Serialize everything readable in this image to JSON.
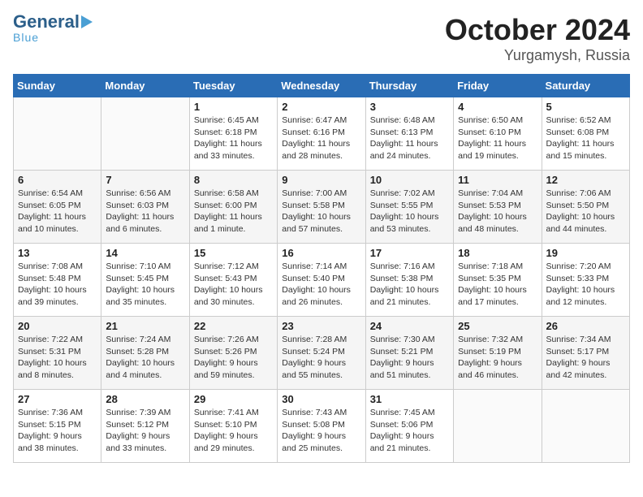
{
  "logo": {
    "line1": "General",
    "line2": "Blue"
  },
  "title": {
    "month": "October 2024",
    "location": "Yurgamysh, Russia"
  },
  "headers": [
    "Sunday",
    "Monday",
    "Tuesday",
    "Wednesday",
    "Thursday",
    "Friday",
    "Saturday"
  ],
  "weeks": [
    [
      {
        "day": "",
        "detail": ""
      },
      {
        "day": "",
        "detail": ""
      },
      {
        "day": "1",
        "detail": "Sunrise: 6:45 AM\nSunset: 6:18 PM\nDaylight: 11 hours\nand 33 minutes."
      },
      {
        "day": "2",
        "detail": "Sunrise: 6:47 AM\nSunset: 6:16 PM\nDaylight: 11 hours\nand 28 minutes."
      },
      {
        "day": "3",
        "detail": "Sunrise: 6:48 AM\nSunset: 6:13 PM\nDaylight: 11 hours\nand 24 minutes."
      },
      {
        "day": "4",
        "detail": "Sunrise: 6:50 AM\nSunset: 6:10 PM\nDaylight: 11 hours\nand 19 minutes."
      },
      {
        "day": "5",
        "detail": "Sunrise: 6:52 AM\nSunset: 6:08 PM\nDaylight: 11 hours\nand 15 minutes."
      }
    ],
    [
      {
        "day": "6",
        "detail": "Sunrise: 6:54 AM\nSunset: 6:05 PM\nDaylight: 11 hours\nand 10 minutes."
      },
      {
        "day": "7",
        "detail": "Sunrise: 6:56 AM\nSunset: 6:03 PM\nDaylight: 11 hours\nand 6 minutes."
      },
      {
        "day": "8",
        "detail": "Sunrise: 6:58 AM\nSunset: 6:00 PM\nDaylight: 11 hours\nand 1 minute."
      },
      {
        "day": "9",
        "detail": "Sunrise: 7:00 AM\nSunset: 5:58 PM\nDaylight: 10 hours\nand 57 minutes."
      },
      {
        "day": "10",
        "detail": "Sunrise: 7:02 AM\nSunset: 5:55 PM\nDaylight: 10 hours\nand 53 minutes."
      },
      {
        "day": "11",
        "detail": "Sunrise: 7:04 AM\nSunset: 5:53 PM\nDaylight: 10 hours\nand 48 minutes."
      },
      {
        "day": "12",
        "detail": "Sunrise: 7:06 AM\nSunset: 5:50 PM\nDaylight: 10 hours\nand 44 minutes."
      }
    ],
    [
      {
        "day": "13",
        "detail": "Sunrise: 7:08 AM\nSunset: 5:48 PM\nDaylight: 10 hours\nand 39 minutes."
      },
      {
        "day": "14",
        "detail": "Sunrise: 7:10 AM\nSunset: 5:45 PM\nDaylight: 10 hours\nand 35 minutes."
      },
      {
        "day": "15",
        "detail": "Sunrise: 7:12 AM\nSunset: 5:43 PM\nDaylight: 10 hours\nand 30 minutes."
      },
      {
        "day": "16",
        "detail": "Sunrise: 7:14 AM\nSunset: 5:40 PM\nDaylight: 10 hours\nand 26 minutes."
      },
      {
        "day": "17",
        "detail": "Sunrise: 7:16 AM\nSunset: 5:38 PM\nDaylight: 10 hours\nand 21 minutes."
      },
      {
        "day": "18",
        "detail": "Sunrise: 7:18 AM\nSunset: 5:35 PM\nDaylight: 10 hours\nand 17 minutes."
      },
      {
        "day": "19",
        "detail": "Sunrise: 7:20 AM\nSunset: 5:33 PM\nDaylight: 10 hours\nand 12 minutes."
      }
    ],
    [
      {
        "day": "20",
        "detail": "Sunrise: 7:22 AM\nSunset: 5:31 PM\nDaylight: 10 hours\nand 8 minutes."
      },
      {
        "day": "21",
        "detail": "Sunrise: 7:24 AM\nSunset: 5:28 PM\nDaylight: 10 hours\nand 4 minutes."
      },
      {
        "day": "22",
        "detail": "Sunrise: 7:26 AM\nSunset: 5:26 PM\nDaylight: 9 hours\nand 59 minutes."
      },
      {
        "day": "23",
        "detail": "Sunrise: 7:28 AM\nSunset: 5:24 PM\nDaylight: 9 hours\nand 55 minutes."
      },
      {
        "day": "24",
        "detail": "Sunrise: 7:30 AM\nSunset: 5:21 PM\nDaylight: 9 hours\nand 51 minutes."
      },
      {
        "day": "25",
        "detail": "Sunrise: 7:32 AM\nSunset: 5:19 PM\nDaylight: 9 hours\nand 46 minutes."
      },
      {
        "day": "26",
        "detail": "Sunrise: 7:34 AM\nSunset: 5:17 PM\nDaylight: 9 hours\nand 42 minutes."
      }
    ],
    [
      {
        "day": "27",
        "detail": "Sunrise: 7:36 AM\nSunset: 5:15 PM\nDaylight: 9 hours\nand 38 minutes."
      },
      {
        "day": "28",
        "detail": "Sunrise: 7:39 AM\nSunset: 5:12 PM\nDaylight: 9 hours\nand 33 minutes."
      },
      {
        "day": "29",
        "detail": "Sunrise: 7:41 AM\nSunset: 5:10 PM\nDaylight: 9 hours\nand 29 minutes."
      },
      {
        "day": "30",
        "detail": "Sunrise: 7:43 AM\nSunset: 5:08 PM\nDaylight: 9 hours\nand 25 minutes."
      },
      {
        "day": "31",
        "detail": "Sunrise: 7:45 AM\nSunset: 5:06 PM\nDaylight: 9 hours\nand 21 minutes."
      },
      {
        "day": "",
        "detail": ""
      },
      {
        "day": "",
        "detail": ""
      }
    ]
  ]
}
